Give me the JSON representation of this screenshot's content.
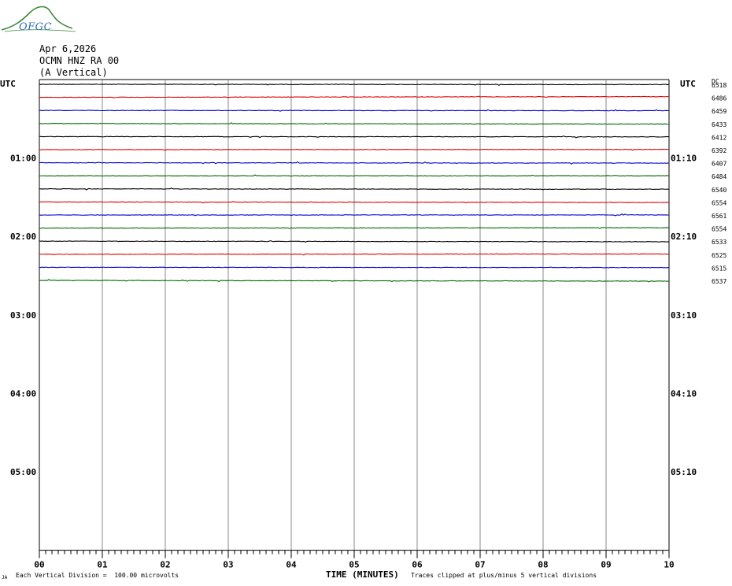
{
  "logo": {
    "text": "OFGC",
    "colors": {
      "hill": "#3a8a3a",
      "text": "#2f6fb3"
    }
  },
  "header": {
    "date": "Apr 6,2026",
    "station": "OCMN HNZ RA 00",
    "component": "(A Vertical)"
  },
  "labels": {
    "utc_left": "UTC",
    "utc_right": "UTC",
    "dc_header": "DC"
  },
  "footer": {
    "corner_mark": "JA",
    "division_note": "Each Vertical Division =  100.00 microvolts",
    "xaxis_title": "TIME (MINUTES)",
    "clip_note": "Traces clipped at plus/minus 5 vertical divisions"
  },
  "chart_data": {
    "type": "line",
    "title": "",
    "xlabel": "TIME (MINUTES)",
    "ylabel": "",
    "xlim": [
      0,
      10
    ],
    "x_ticks": [
      "00",
      "01",
      "02",
      "03",
      "04",
      "05",
      "06",
      "07",
      "08",
      "09",
      "10"
    ],
    "grid": true,
    "trace_colors": [
      "#000000",
      "#dd0000",
      "#0000cc",
      "#006600"
    ],
    "hour_labels_left": [
      "01:00",
      "02:00",
      "03:00",
      "04:00",
      "05:00"
    ],
    "hour_labels_right": [
      "01:10",
      "02:10",
      "03:10",
      "04:10",
      "05:10"
    ],
    "dc_offsets": [
      "6518",
      "6486",
      "6459",
      "6433",
      "6412",
      "6392",
      "6407",
      "6484",
      "6540",
      "6554",
      "6561",
      "6554",
      "6533",
      "6525",
      "6515",
      "6537"
    ],
    "traces_per_hour": 6,
    "total_hours": 6,
    "traces_drawn": 16
  }
}
